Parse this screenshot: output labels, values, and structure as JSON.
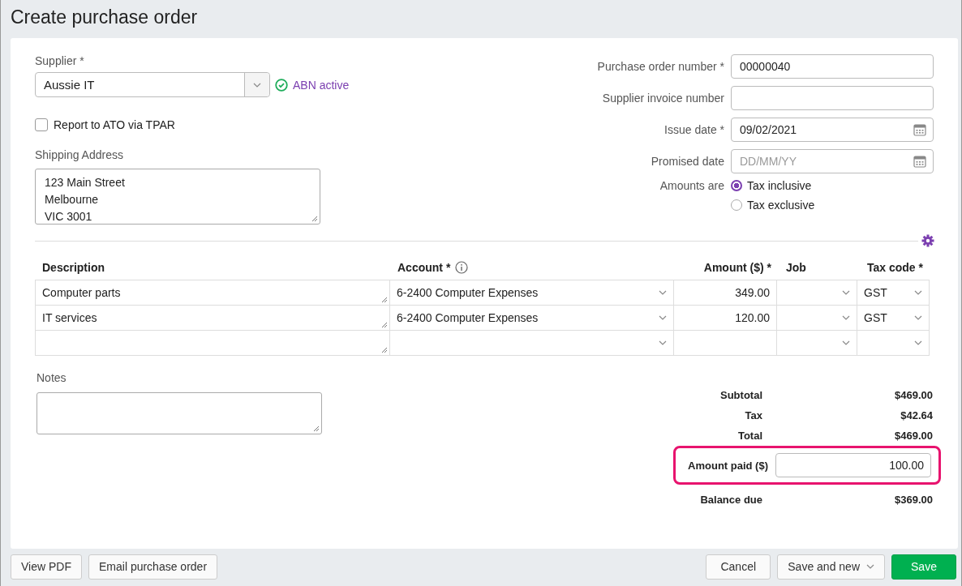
{
  "page": {
    "title": "Create purchase order"
  },
  "supplier": {
    "label": "Supplier *",
    "value": "Aussie IT",
    "abn_status": "ABN active"
  },
  "report_tpar": {
    "label": "Report to ATO via TPAR",
    "checked": false
  },
  "shipping_address": {
    "label": "Shipping Address",
    "lines": [
      "123 Main Street",
      "Melbourne",
      "VIC 3001"
    ]
  },
  "fields": [
    {
      "label": "Purchase order number *",
      "kind": "text",
      "value": "00000040"
    },
    {
      "label": "Supplier invoice number",
      "kind": "text"
    },
    {
      "label": "Issue date *",
      "kind": "date",
      "value": "09/02/2021"
    },
    {
      "label": "Promised date",
      "kind": "date",
      "placeholder": "DD/MM/YY"
    }
  ],
  "amounts_are": {
    "label": "Amounts are",
    "options": [
      {
        "label": "Tax inclusive",
        "selected": true
      },
      {
        "label": "Tax exclusive",
        "selected": false
      }
    ]
  },
  "table": {
    "columns": [
      {
        "label": "Description",
        "kind": "text",
        "info": false
      },
      {
        "label": "Account *",
        "kind": "select",
        "info": true
      },
      {
        "label": "Amount ($) *",
        "kind": "number",
        "info": false
      },
      {
        "label": "Job",
        "kind": "select",
        "info": false
      },
      {
        "label": "Tax code *",
        "kind": "select",
        "info": false
      }
    ],
    "rows": [
      {
        "cells": [
          "Computer parts",
          "6-2400 Computer Expenses",
          "349.00",
          "",
          "GST"
        ]
      },
      {
        "cells": [
          "IT services",
          "6-2400 Computer Expenses",
          "120.00",
          "",
          "GST"
        ]
      },
      {
        "cells": [
          "",
          "",
          "",
          "",
          ""
        ]
      }
    ]
  },
  "notes": {
    "label": "Notes"
  },
  "totals": [
    {
      "label": "Subtotal",
      "value": "$469.00"
    },
    {
      "label": "Tax",
      "value": "$42.64"
    },
    {
      "label": "Total",
      "value": "$469.00"
    }
  ],
  "amount_paid": {
    "label": "Amount paid ($)",
    "value": "100.00",
    "highlighted": true
  },
  "balance_due": {
    "label": "Balance due",
    "value": "$369.00"
  },
  "footer": {
    "left_buttons": [
      "View PDF",
      "Email purchase order"
    ],
    "right_buttons": [
      {
        "label": "Cancel",
        "kind": "plain"
      },
      {
        "label": "Save and new",
        "kind": "split"
      },
      {
        "label": "Save",
        "kind": "primary"
      }
    ]
  }
}
